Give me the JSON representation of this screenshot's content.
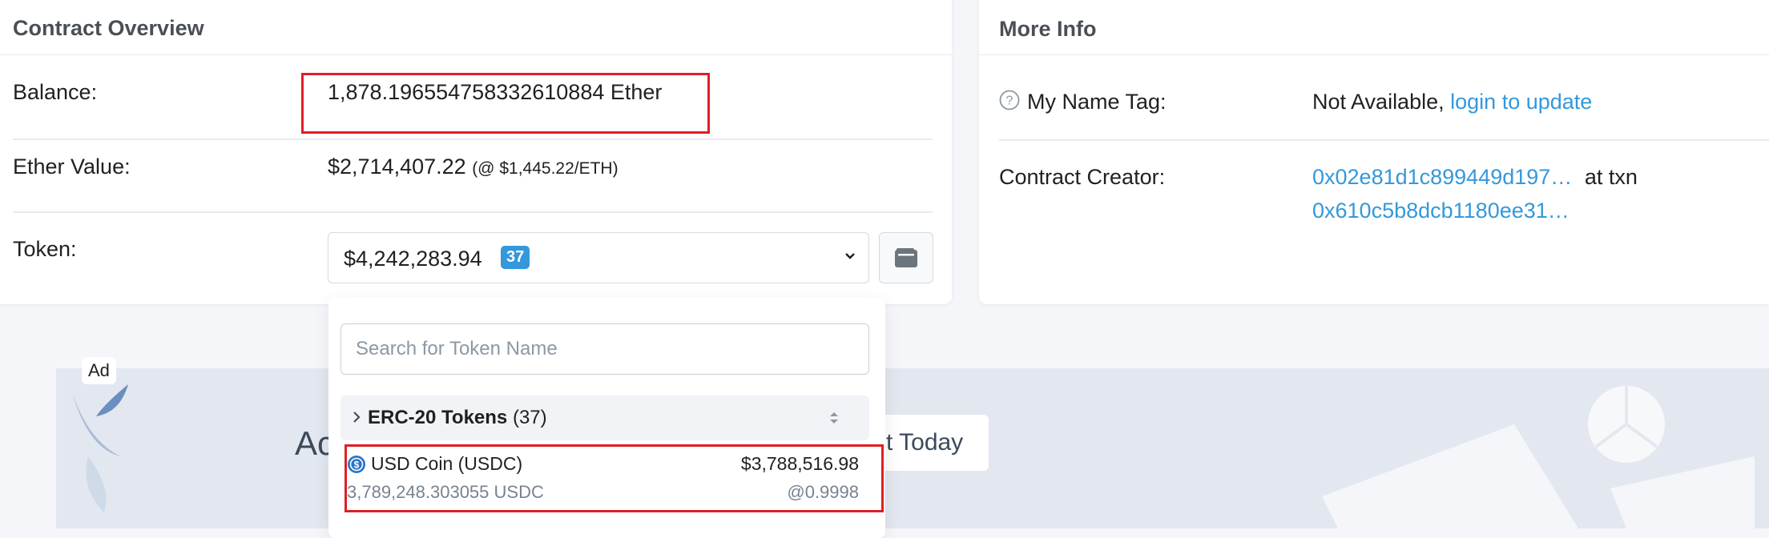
{
  "overview": {
    "title": "Contract Overview",
    "balance_label": "Balance:",
    "balance_value": "1,878.196554758332610884 Ether",
    "ether_value_label": "Ether Value:",
    "ether_value": "$2,714,407.22",
    "ether_price": "(@ $1,445.22/ETH)",
    "token_label": "Token:",
    "token_total": "$4,242,283.94",
    "token_count": "37"
  },
  "more_info": {
    "title": "More Info",
    "name_tag_label": "My Name Tag:",
    "name_tag_value": "Not Available,",
    "name_tag_link": "login to update",
    "creator_label": "Contract Creator:",
    "creator_address": "0x02e81d1c899449d197…",
    "creator_at": "at txn",
    "creator_txn": "0x610c5b8dcb1180ee31…"
  },
  "dropdown": {
    "search_placeholder": "Search for Token Name",
    "group_name": "ERC-20 Tokens",
    "group_count": "(37)",
    "tokens": [
      {
        "name": "USD Coin (USDC)",
        "value": "$3,788,516.98",
        "amount": "3,789,248.303055 USDC",
        "rate": "@0.9998"
      }
    ]
  },
  "ad": {
    "label": "Ad",
    "text": "Ac",
    "cta": "t Today"
  },
  "colors": {
    "accent": "#3498db",
    "highlight": "#de1f26",
    "usdc": "#2775ca"
  },
  "icons": [
    "question-circle-icon",
    "chevron-down-icon",
    "wallet-icon",
    "chevron-right-icon",
    "sort-icon",
    "usdc-coin-icon"
  ]
}
